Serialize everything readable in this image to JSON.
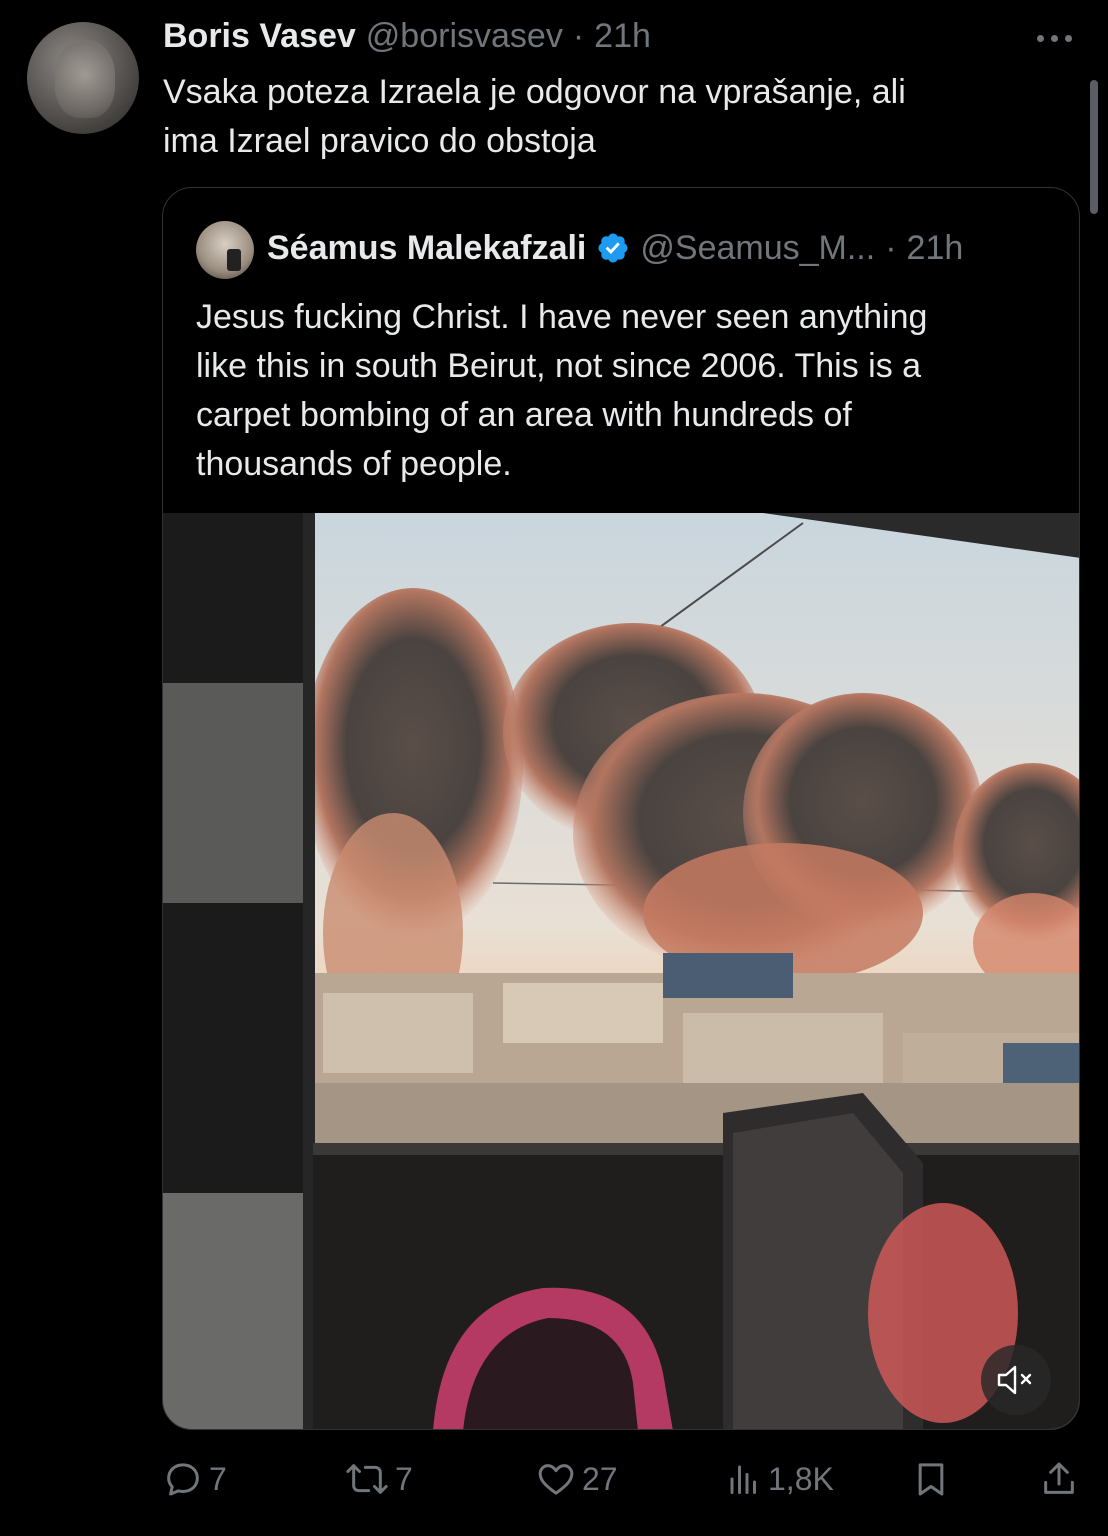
{
  "tweet": {
    "author_name": "Boris Vasev",
    "author_handle": "@borisvasev",
    "separator": "·",
    "time": "21h",
    "text_line1": "Vsaka poteza Izraela je odgovor na vprašanje, ali",
    "text_line2": "ima Izrael pravico do obstoja"
  },
  "quote": {
    "author_name": "Séamus Malekafzali",
    "author_handle": "@Seamus_M...",
    "separator": "·",
    "time": "21h",
    "text_line1": "Jesus fucking Christ. I have never seen anything",
    "text_line2": "like this in south Beirut, not since 2006. This is a",
    "text_line3": "carpet bombing of an area with hundreds of",
    "text_line4": "thousands of people.",
    "media_icon": "mute-icon"
  },
  "actions": {
    "replies": "7",
    "retweets": "7",
    "likes": "27",
    "views": "1,8K"
  },
  "colors": {
    "background": "#000000",
    "text": "#e7e9ea",
    "muted": "#71767b",
    "verified": "#1d9bf0",
    "border": "#2f3336"
  }
}
